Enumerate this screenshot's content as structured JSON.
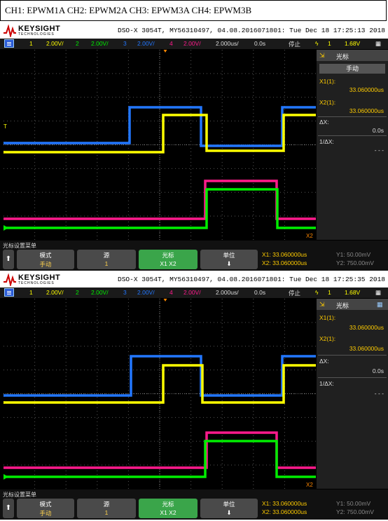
{
  "caption": "CH1: EPWM1A  CH2: EPWM2A CH3: EPWM3A  CH4: EPWM3B",
  "brand": {
    "name": "KEYSIGHT",
    "sub": "TECHNOLOGIES"
  },
  "colors": {
    "ch1": "#ffff00",
    "ch2": "#00ee00",
    "ch3": "#2277ff",
    "ch4": "#ff1a8c",
    "trigger": "#ff8800"
  },
  "scopes": [
    {
      "info": "DSO-X 3054T, MY56310497, 04.08.2016071801: Tue Dec 18 17:25:13 2018",
      "channels": [
        {
          "num": "1",
          "scale": "2.00V/"
        },
        {
          "num": "2",
          "scale": "2.00V/"
        },
        {
          "num": "3",
          "scale": "2.00V/"
        },
        {
          "num": "4",
          "scale": "2.00V/"
        }
      ],
      "timebase": "2.000us/",
      "delay": "0.0s",
      "run_state": "停止",
      "trig_ch": "1",
      "trig_level": "1.68V",
      "panel": {
        "title": "光标",
        "mode": "手动",
        "x1_label": "X1(1):",
        "x1_value": "33.060000us",
        "x2_label": "X2(1):",
        "x2_value": "33.060000us",
        "dx_label": "ΔX:",
        "dx_value": "0.0s",
        "inv_label": "1/ΔX:",
        "inv_value": "- - -"
      },
      "menu_title": "光标设置菜单",
      "softkeys": [
        {
          "l1": "模式",
          "l2": "手动"
        },
        {
          "l1": "源",
          "l2": "1"
        },
        {
          "l1": "光标",
          "l2": "X1 X2"
        },
        {
          "l1": "单位",
          "l2": ""
        }
      ],
      "readout": {
        "x1": "X1: 33.060000us",
        "x2": "X2: 33.060000us",
        "y1": "Y1: 50.00mV",
        "y2": "Y2: 750.00mV"
      },
      "x2_marker": "X2"
    },
    {
      "info": "DSO-X 3054T, MY56310497, 04.08.2016071801: Tue Dec 18 17:25:35 2018",
      "channels": [
        {
          "num": "1",
          "scale": "2.00V/"
        },
        {
          "num": "2",
          "scale": "2.00V/"
        },
        {
          "num": "3",
          "scale": "2.00V/"
        },
        {
          "num": "4",
          "scale": "2.00V/"
        }
      ],
      "timebase": "2.000us/",
      "delay": "0.0s",
      "run_state": "停止",
      "trig_ch": "1",
      "trig_level": "1.68V",
      "panel": {
        "title": "光标",
        "mode": "",
        "x1_label": "X1(1):",
        "x1_value": "33.060000us",
        "x2_label": "X2(1):",
        "x2_value": "33.060000us",
        "dx_label": "ΔX:",
        "dx_value": "0.0s",
        "inv_label": "1/ΔX:",
        "inv_value": "- - -"
      },
      "menu_title": "光标设置菜单",
      "softkeys": [
        {
          "l1": "模式",
          "l2": "手动"
        },
        {
          "l1": "源",
          "l2": "1"
        },
        {
          "l1": "光标",
          "l2": "X1 X2"
        },
        {
          "l1": "单位",
          "l2": ""
        }
      ],
      "readout": {
        "x1": "X1: 33.060000us",
        "x2": "X2: 33.060000us",
        "y1": "Y1: 50.00mV",
        "y2": "Y2: 750.00mV"
      },
      "x2_marker": "X2"
    }
  ]
}
